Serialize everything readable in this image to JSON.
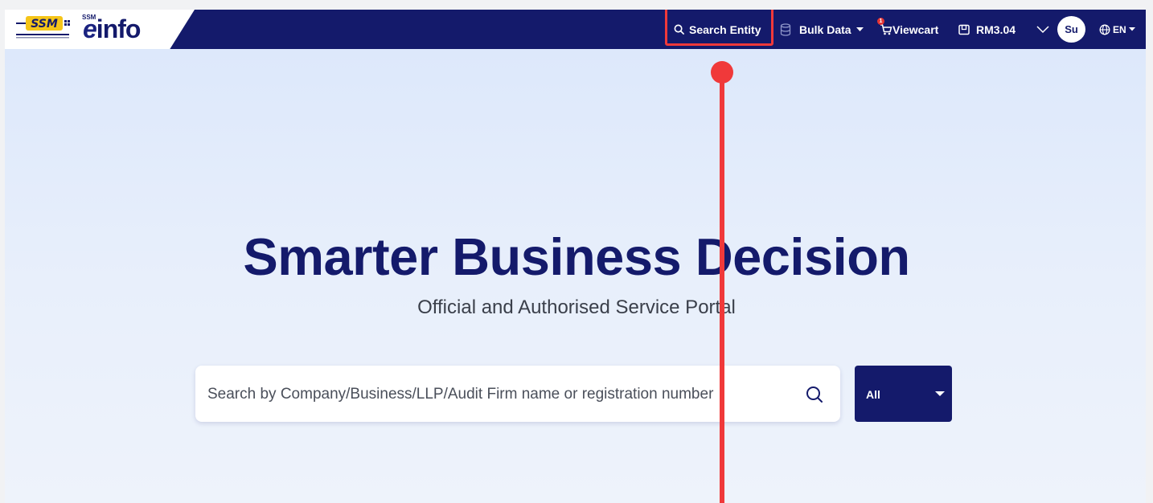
{
  "header": {
    "brand": {
      "ssm_label": "SSM",
      "einfo_prefix": "e",
      "einfo_suffix": "info"
    },
    "nav": {
      "search_entity": "Search Entity",
      "bulk_data": "Bulk Data",
      "viewcart": "Viewcart",
      "cart_count": "1",
      "balance": "RM3.04",
      "avatar_initials": "Su",
      "language": "EN"
    }
  },
  "hero": {
    "title": "Smarter Business Decision",
    "subtitle": "Official and Authorised Service Portal"
  },
  "search": {
    "placeholder": "Search by Company/Business/LLP/Audit Firm name or registration number",
    "filter_value": "All"
  },
  "annotation": {
    "highlight_color": "#f0393a"
  },
  "colors": {
    "navy": "#141a6b",
    "background": "#dbe7fb"
  }
}
